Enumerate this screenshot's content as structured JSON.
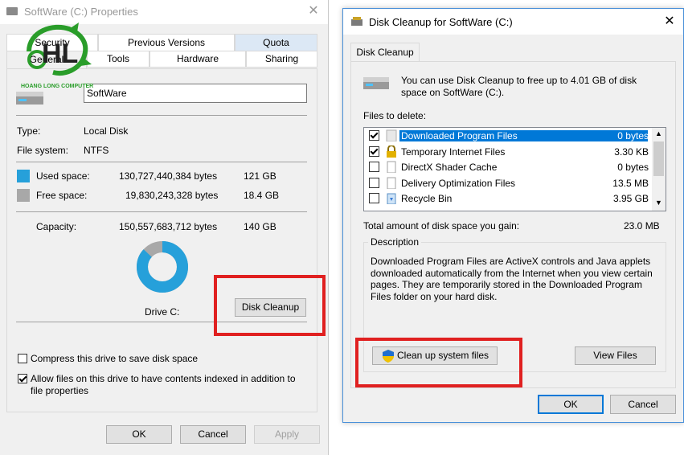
{
  "properties": {
    "title": "SoftWare (C:) Properties",
    "tabs_top": [
      "Security",
      "Previous Versions",
      "Quota"
    ],
    "tabs_bottom": [
      "General",
      "Tools",
      "Hardware",
      "Sharing"
    ],
    "drive_name_value": "SoftWare",
    "type_label": "Type:",
    "type_value": "Local Disk",
    "fs_label": "File system:",
    "fs_value": "NTFS",
    "used": {
      "label": "Used space:",
      "bytes": "130,727,440,384 bytes",
      "size": "121 GB",
      "color": "#26a0da"
    },
    "free": {
      "label": "Free space:",
      "bytes": "19,830,243,328 bytes",
      "size": "18.4 GB",
      "color": "#a8a8a8"
    },
    "capacity": {
      "label": "Capacity:",
      "bytes": "150,557,683,712 bytes",
      "size": "140 GB"
    },
    "used_fraction": 0.868,
    "drive_label": "Drive C:",
    "disk_cleanup_button": "Disk Cleanup",
    "compress_label": "Compress this drive to save disk space",
    "compress_checked": false,
    "index_label_1": "Allow files on this drive to have contents indexed in addition to",
    "index_label_2": "file properties",
    "index_checked": true,
    "ok": "OK",
    "cancel": "Cancel",
    "apply": "Apply"
  },
  "logo": {
    "initials": "HL",
    "text": "HOANG LONG COMPUTER",
    "color": "#2a9d2a"
  },
  "cleanup": {
    "title": "Disk Cleanup for SoftWare (C:)",
    "tab": "Disk Cleanup",
    "intro_1": "You can use Disk Cleanup to free up to 4.01 GB of disk",
    "intro_2": "space on SoftWare (C:).",
    "files_label": "Files to delete:",
    "files": [
      {
        "name": "Downloaded Program Files",
        "size": "0 bytes",
        "checked": true,
        "selected": true,
        "icon": "folder-icon"
      },
      {
        "name": "Temporary Internet Files",
        "size": "3.30 KB",
        "checked": true,
        "selected": false,
        "icon": "lock-icon"
      },
      {
        "name": "DirectX Shader Cache",
        "size": "0 bytes",
        "checked": false,
        "selected": false,
        "icon": "file-icon"
      },
      {
        "name": "Delivery Optimization Files",
        "size": "13.5 MB",
        "checked": false,
        "selected": false,
        "icon": "file-icon"
      },
      {
        "name": "Recycle Bin",
        "size": "3.95 GB",
        "checked": false,
        "selected": false,
        "icon": "recycle-bin-icon"
      }
    ],
    "total_label": "Total amount of disk space you gain:",
    "total_value": "23.0 MB",
    "description_label": "Description",
    "description_lines": [
      "Downloaded Program Files are ActiveX controls and Java applets",
      "downloaded automatically from the Internet when you view certain",
      "pages. They are temporarily stored in the Downloaded Program",
      "Files folder on your hard disk."
    ],
    "clean_system_button": "Clean up system files",
    "view_files_button": "View Files",
    "ok": "OK",
    "cancel": "Cancel",
    "highlight_color": "#e02020",
    "selection_color": "#0078d7"
  }
}
